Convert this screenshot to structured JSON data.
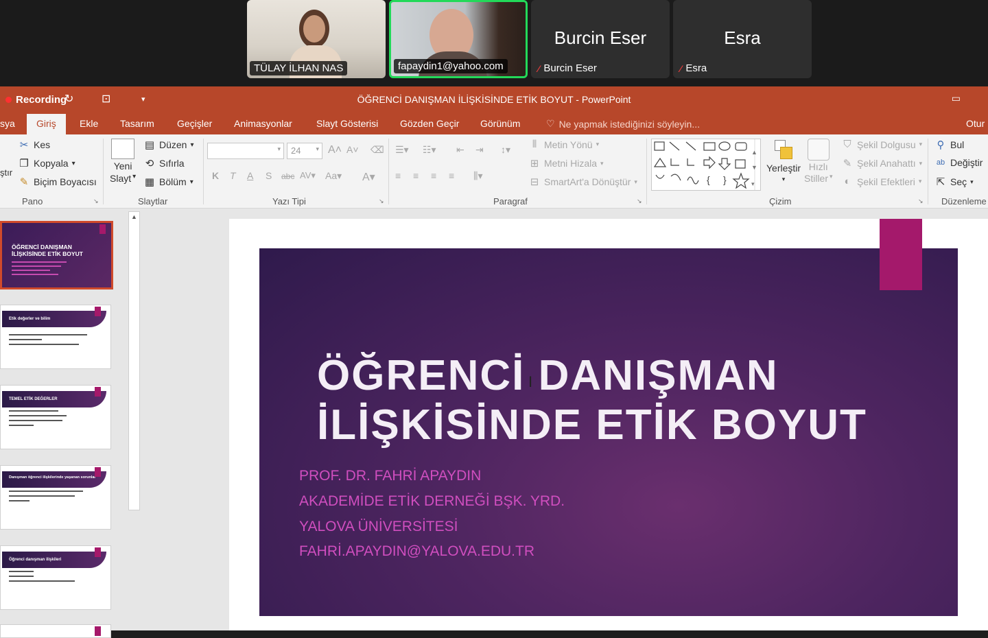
{
  "participants": [
    {
      "name": "TÜLAY İLHAN NAS",
      "video": true,
      "active": false,
      "muted": false
    },
    {
      "name": "fapaydin1@yahoo.com",
      "video": true,
      "active": true,
      "muted": false
    },
    {
      "name": "Burcin Eser",
      "display": "Burcin Eser",
      "video": false,
      "active": false,
      "muted": true
    },
    {
      "name": "Esra",
      "display": "Esra",
      "video": false,
      "active": false,
      "muted": true
    }
  ],
  "titlebar": {
    "recording": "Recording",
    "document_title": "ÖĞRENCİ DANIŞMAN İLİŞKİSİNDE ETİK BOYUT - PowerPoint"
  },
  "tabs": {
    "file": "sya",
    "home": "Giriş",
    "insert": "Ekle",
    "design": "Tasarım",
    "transitions": "Geçişler",
    "animations": "Animasyonlar",
    "slideshow": "Slayt Gösterisi",
    "review": "Gözden Geçir",
    "view": "Görünüm",
    "tell_me": "Ne yapmak istediğinizi söyleyin...",
    "account": "Otur"
  },
  "ribbon": {
    "clipboard": {
      "paste": "ştır",
      "cut": "Kes",
      "copy": "Kopyala",
      "format_painter": "Biçim Boyacısı",
      "label": "Pano"
    },
    "slides": {
      "new_slide_1": "Yeni",
      "new_slide_2": "Slayt",
      "layout": "Düzen",
      "reset": "Sıfırla",
      "section": "Bölüm",
      "label": "Slaytlar"
    },
    "font": {
      "size": "24",
      "label": "Yazı Tipi"
    },
    "paragraph": {
      "text_direction": "Metin Yönü",
      "align_text": "Metni Hizala",
      "smartart": "SmartArt'a Dönüştür",
      "label": "Paragraf"
    },
    "drawing": {
      "arrange": "Yerleştir",
      "quick_styles_1": "Hızlı",
      "quick_styles_2": "Stiller",
      "shape_fill": "Şekil Dolgusu",
      "shape_outline": "Şekil Anahattı",
      "shape_effects": "Şekil Efektleri",
      "label": "Çizim"
    },
    "editing": {
      "find": "Bul",
      "replace": "Değiştir",
      "select": "Seç",
      "label": "Düzenleme"
    }
  },
  "thumbnails": [
    {
      "title": "ÖĞRENCİ DANIŞMAN İLİŞKİSİNDE ETİK BOYUT"
    },
    {
      "title": "Etik değerler ve bilim"
    },
    {
      "title": "TEMEL ETİK DEĞERLER"
    },
    {
      "title": "Danışman öğrenci ilişkilerinde yaşanan sorunlar"
    },
    {
      "title": "Öğrenci danışman ilişkileri"
    }
  ],
  "slide": {
    "title_line1": "ÖĞRENCİ DANIŞMAN",
    "title_line2": "İLİŞKİSİNDE ETİK BOYUT",
    "author": "PROF. DR. FAHRİ APAYDIN",
    "role": "AKADEMİDE ETİK DERNEĞİ BŞK. YRD.",
    "university": "YALOVA ÜNİVERSİTESİ",
    "email": "FAHRİ.APAYDIN@YALOVA.EDU.TR"
  },
  "colors": {
    "accent": "#b7472a",
    "slide_accent": "#a4196b",
    "subtitle": "#d04ebf",
    "active_speaker": "#23d959"
  }
}
